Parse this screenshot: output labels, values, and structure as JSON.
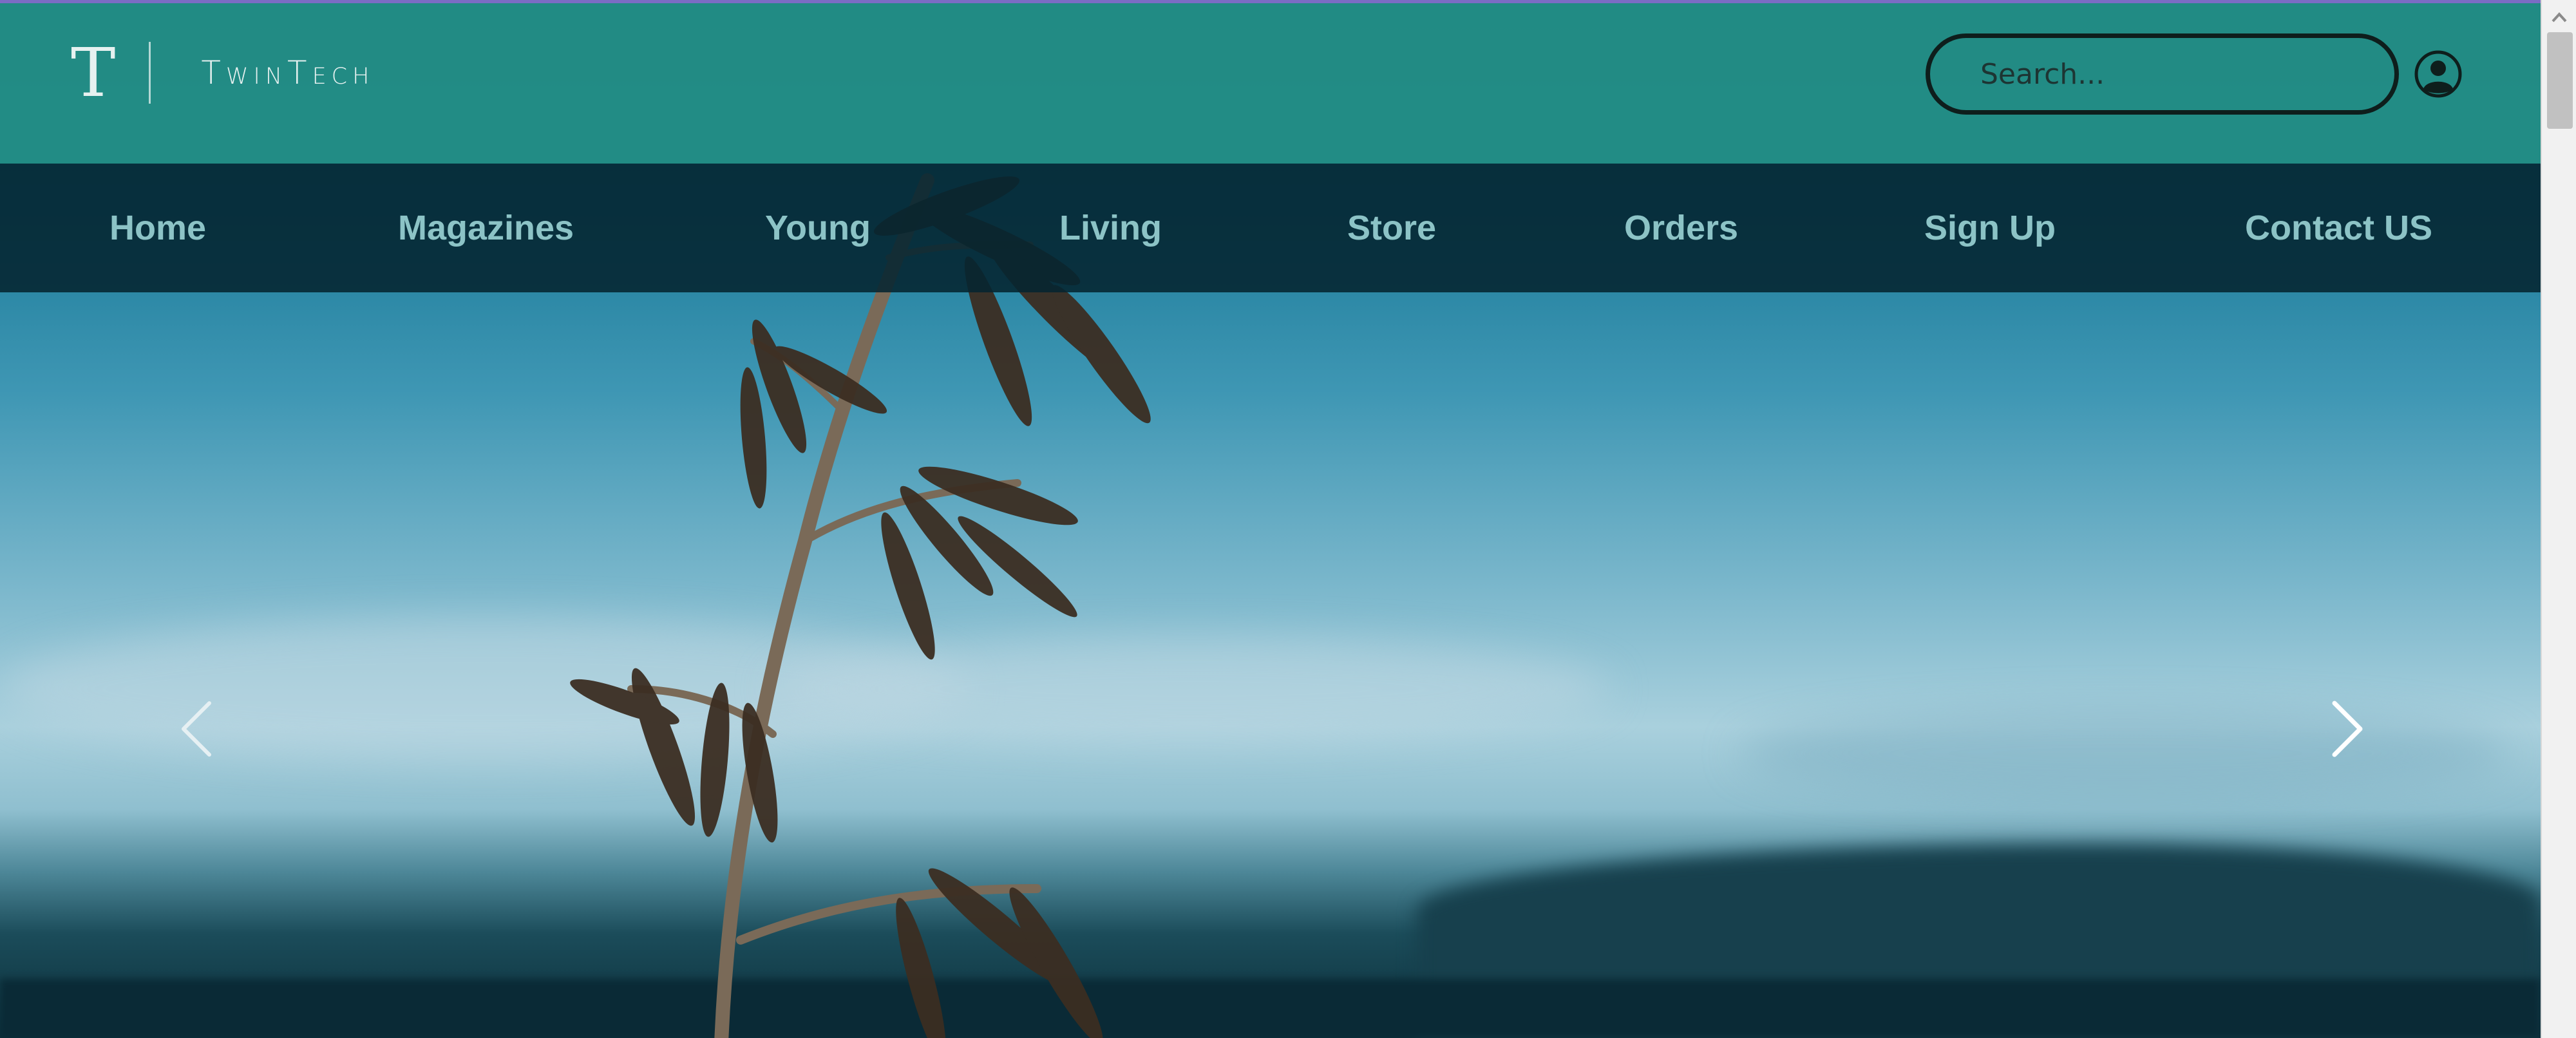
{
  "brand": {
    "logo_mark": "T",
    "name": "TwinTech"
  },
  "search": {
    "placeholder": "Search..."
  },
  "nav": {
    "items": [
      {
        "label": "Home"
      },
      {
        "label": "Magazines"
      },
      {
        "label": "Young"
      },
      {
        "label": "Living"
      },
      {
        "label": "Store"
      },
      {
        "label": "Orders"
      },
      {
        "label": "Sign Up"
      },
      {
        "label": "Contact US"
      }
    ]
  },
  "carousel": {
    "prev_icon": "chevron-left-icon",
    "next_icon": "chevron-right-icon"
  },
  "icons": {
    "user": "user-circle-icon"
  },
  "colors": {
    "header_bg": "#248e84",
    "nav_bg": "#042430",
    "nav_text": "#8cc3c6",
    "brand_text": "#e6f1f0"
  }
}
